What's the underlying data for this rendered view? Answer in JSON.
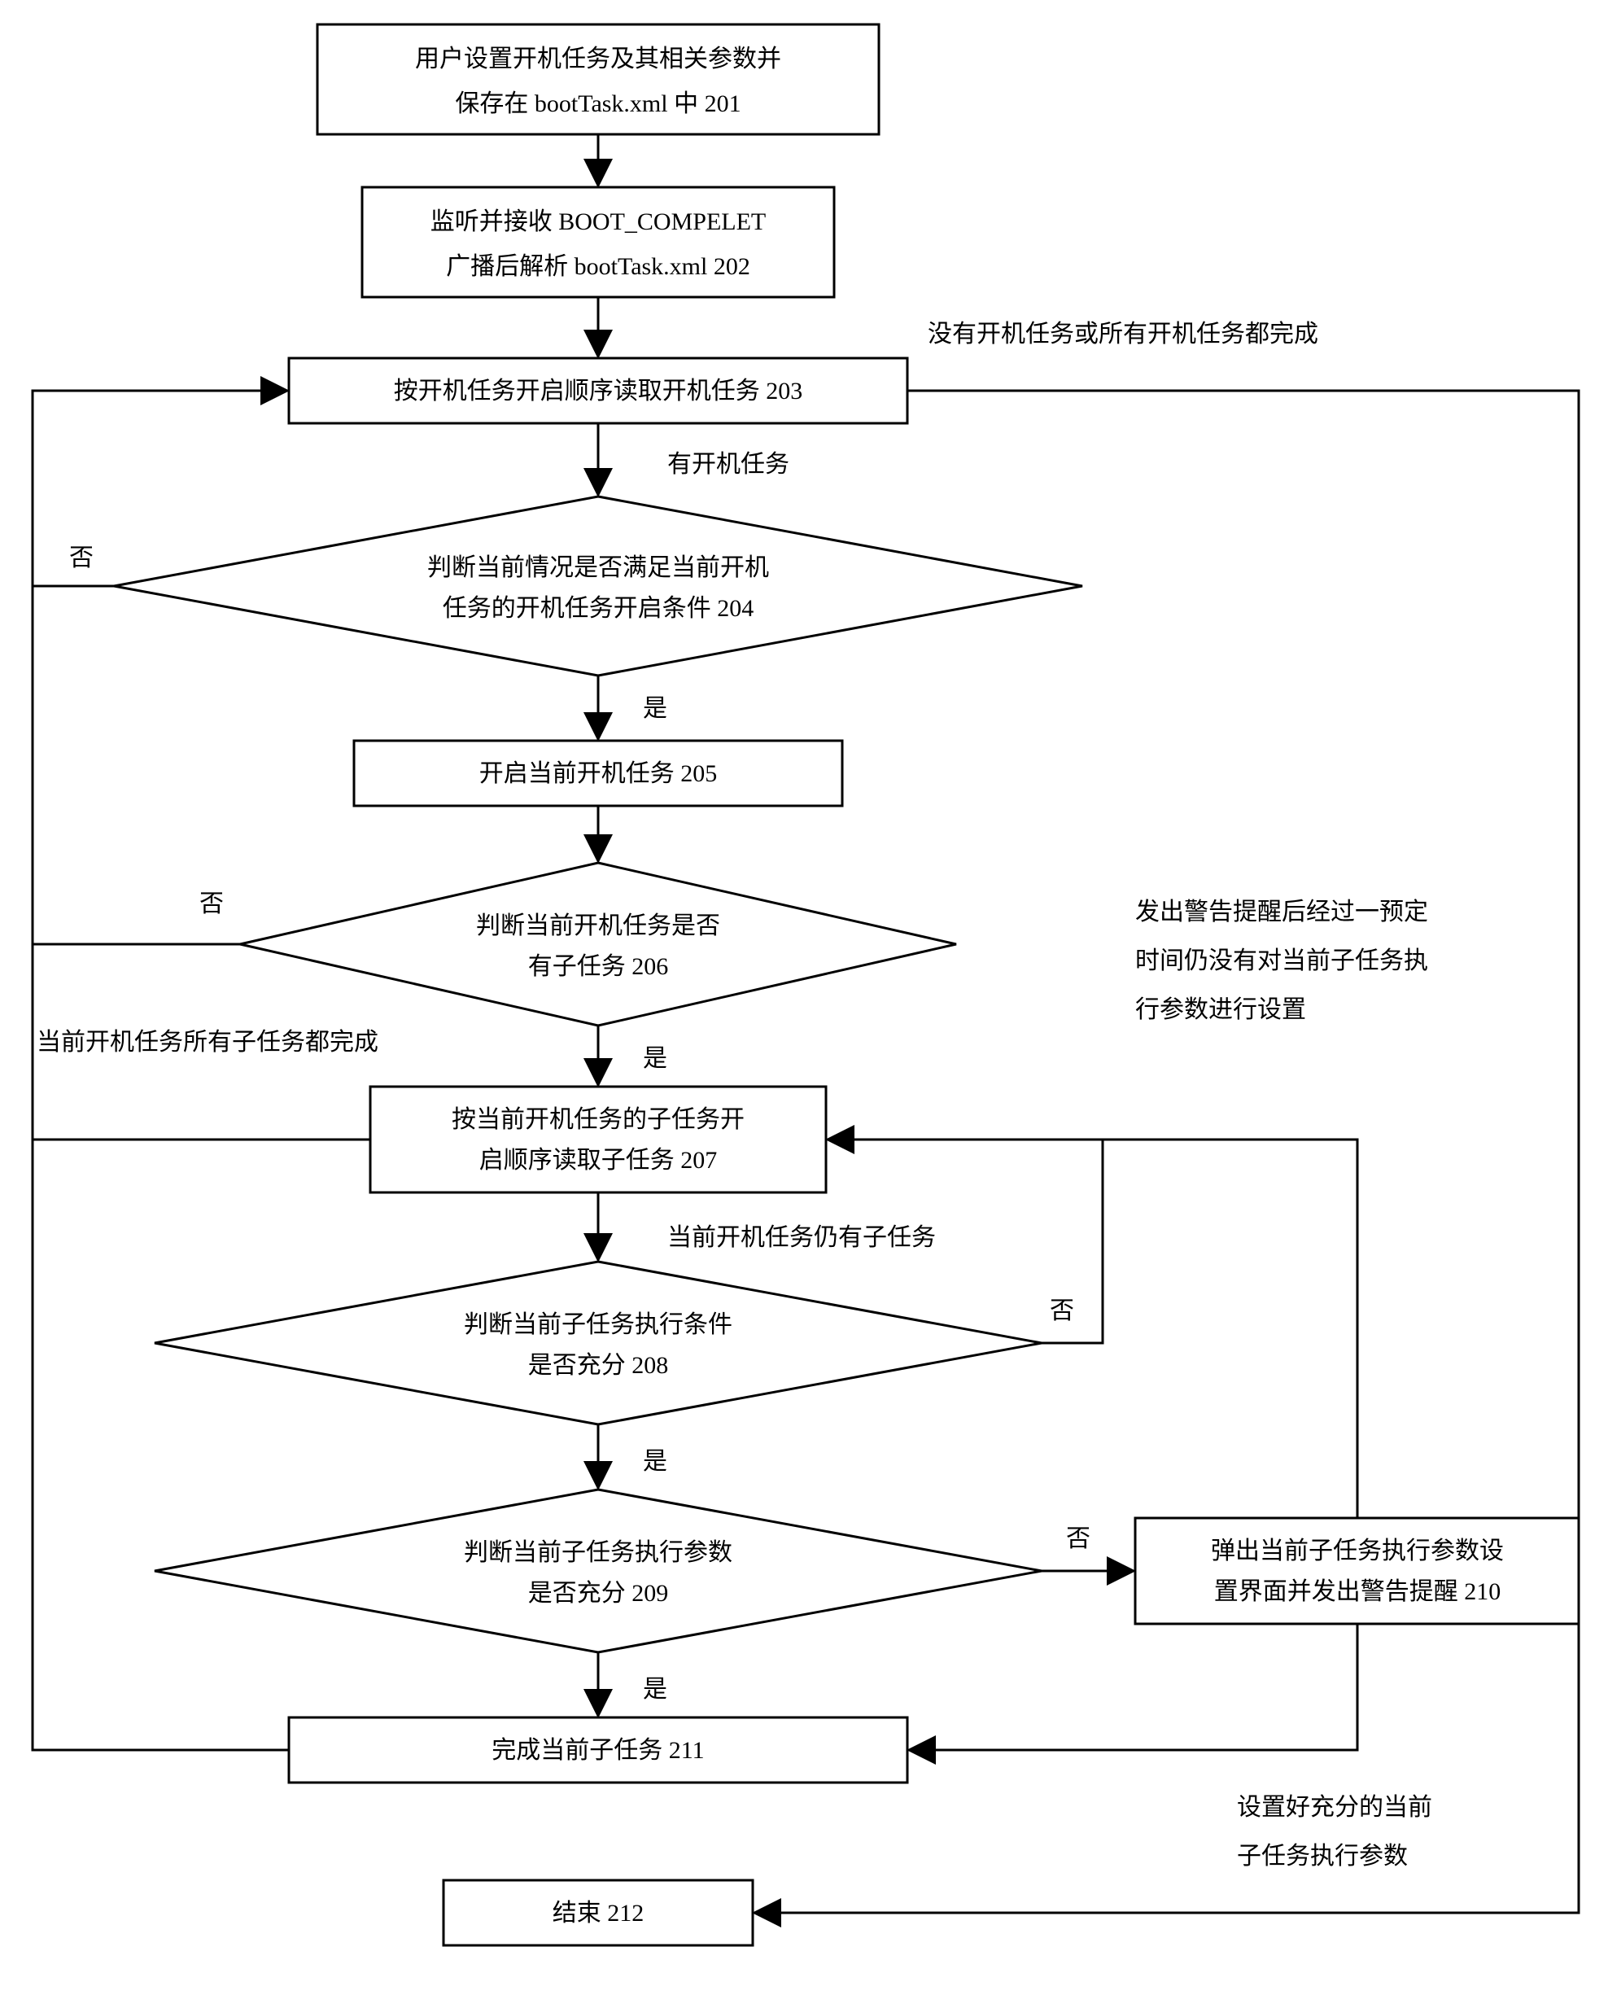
{
  "nodes": {
    "n201": {
      "line1": "用户设置开机任务及其相关参数并",
      "line2": "保存在 bootTask.xml 中 201"
    },
    "n202": {
      "line1": "监听并接收 BOOT_COMPELET",
      "line2": "广播后解析 bootTask.xml 202"
    },
    "n203": {
      "line1": "按开机任务开启顺序读取开机任务 203"
    },
    "n204": {
      "line1": "判断当前情况是否满足当前开机",
      "line2": "任务的开机任务开启条件 204"
    },
    "n205": {
      "line1": "开启当前开机任务 205"
    },
    "n206": {
      "line1": "判断当前开机任务是否",
      "line2": "有子任务 206"
    },
    "n207": {
      "line1": "按当前开机任务的子任务开",
      "line2": "启顺序读取子任务 207"
    },
    "n208": {
      "line1": "判断当前子任务执行条件",
      "line2": "是否充分 208"
    },
    "n209": {
      "line1": "判断当前子任务执行参数",
      "line2": "是否充分 209"
    },
    "n210": {
      "line1": "弹出当前子任务执行参数设",
      "line2": "置界面并发出警告提醒 210"
    },
    "n211": {
      "line1": "完成当前子任务 211"
    },
    "n212": {
      "line1": "结束 212"
    }
  },
  "labels": {
    "no_task_or_done": "没有开机任务或所有开机任务都完成",
    "has_task": "有开机任务",
    "no": "否",
    "yes": "是",
    "all_subtasks_done": "当前开机任务所有子任务都完成",
    "still_has_subtask": "当前开机任务仍有子任务",
    "warn_l1": "发出警告提醒后经过一预定",
    "warn_l2": "时间仍没有对当前子任务执",
    "warn_l3": "行参数进行设置",
    "set_params_l1": "设置好充分的当前",
    "set_params_l2": "子任务执行参数"
  }
}
